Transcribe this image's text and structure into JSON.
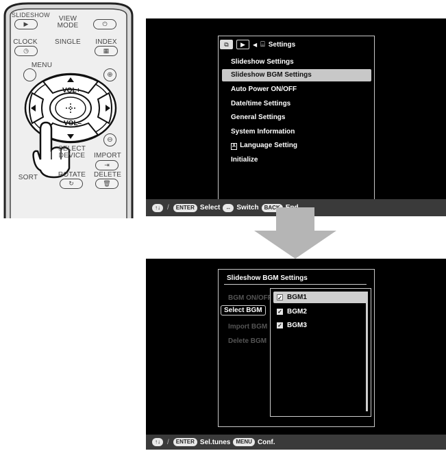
{
  "remote": {
    "slideshow": "SLIDESHOW",
    "view_mode": "VIEW\nMODE",
    "clock": "CLOCK",
    "single": "SINGLE",
    "index": "INDEX",
    "menu": "MENU",
    "vol_up": "VOL+",
    "vol_down": "VOL–",
    "select_device": "SELECT\nDEVICE",
    "import": "IMPORT",
    "sort": "SORT",
    "rotate": "ROTATE",
    "delete": "DELETE"
  },
  "screen1": {
    "header_title": "Settings",
    "menu_items": [
      "Slideshow Settings",
      "Slideshow BGM Settings",
      "Auto Power ON/OFF",
      "Date/time Settings",
      "General Settings",
      "System Information",
      "Language Setting",
      "Initialize"
    ],
    "selected_index": 1,
    "status": {
      "key_arrows": "↑↓",
      "slash": "/",
      "key_enter": "ENTER",
      "select_label": "Select",
      "key_switch": "↔",
      "switch_label": "Switch",
      "key_back": "BACK",
      "end_label": "End"
    }
  },
  "screen2": {
    "title": "Slideshow BGM Settings",
    "left_items": [
      "BGM ON/OFF",
      "Select BGM",
      "Import BGM",
      "Delete BGM"
    ],
    "left_active_index": 1,
    "bgm_list": [
      {
        "label": "BGM1",
        "checked": true
      },
      {
        "label": "BGM2",
        "checked": true
      },
      {
        "label": "BGM3",
        "checked": true
      }
    ],
    "selected_bgm_index": 0,
    "status": {
      "key_arrows": "↑↓",
      "slash": "/",
      "key_enter": "ENTER",
      "sel_label": "Sel.tunes",
      "key_menu": "MENU",
      "conf_label": "Conf."
    }
  },
  "colors": {
    "screen_bg": "#000000",
    "status_bar": "#3a3a3a",
    "highlight": "#c8c8c8",
    "arrow": "#b5b5b5"
  }
}
